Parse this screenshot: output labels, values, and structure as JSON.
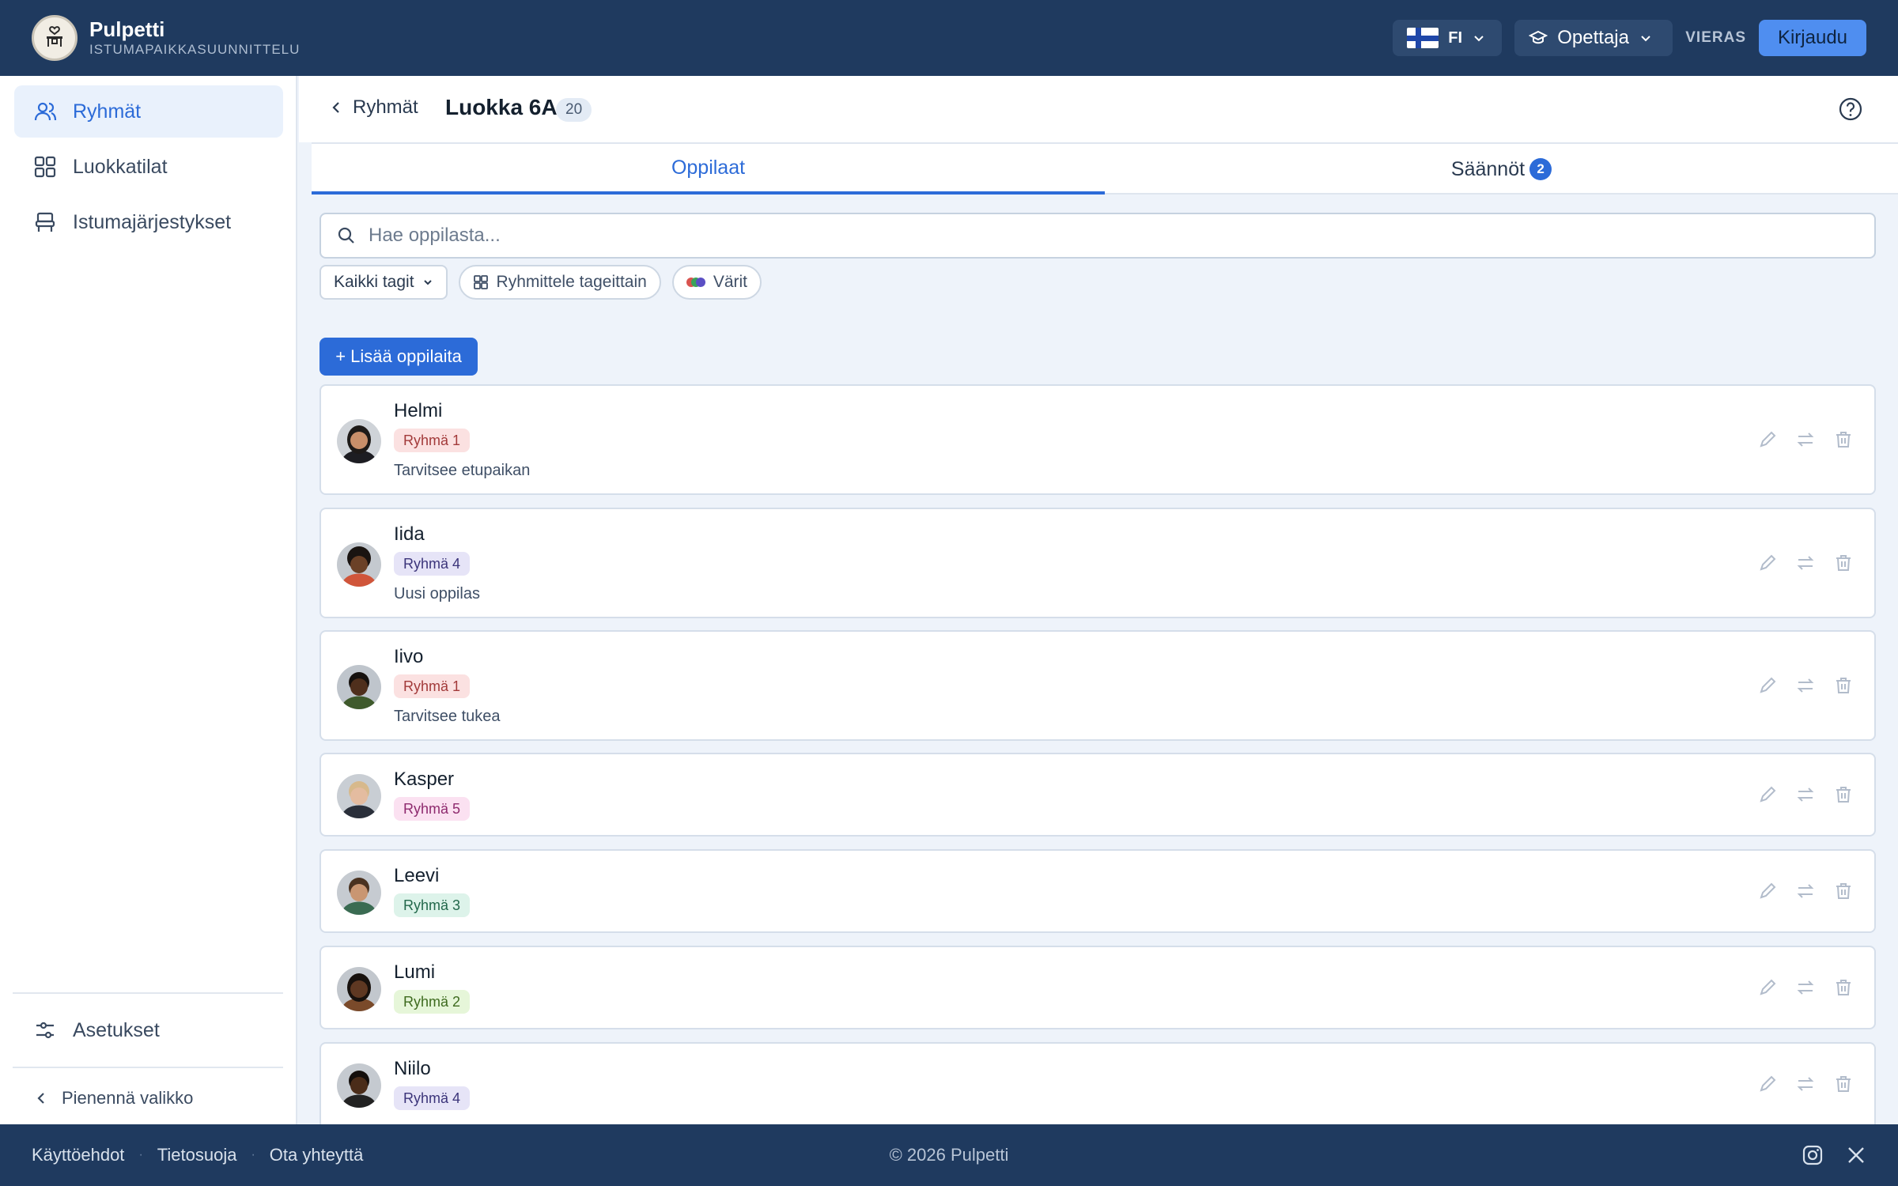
{
  "header": {
    "brand_name": "Pulpetti",
    "brand_subtitle": "ISTUMAPAIKKASUUNNITTELU",
    "language": "FI",
    "role": "Opettaja",
    "guest_label": "VIERAS",
    "login_label": "Kirjaudu"
  },
  "sidebar": {
    "items": [
      {
        "label": "Ryhmät",
        "icon": "users-icon",
        "active": true
      },
      {
        "label": "Luokkatilat",
        "icon": "grid-icon",
        "active": false
      },
      {
        "label": "Istumajärjestykset",
        "icon": "seat-icon",
        "active": false
      }
    ],
    "settings_label": "Asetukset",
    "collapse_label": "Pienennä valikko"
  },
  "page": {
    "back_label": "Ryhmät",
    "title": "Luokka 6A",
    "student_count": "20",
    "tabs": [
      {
        "label": "Oppilaat",
        "active": true
      },
      {
        "label": "Säännöt",
        "badge": "2",
        "active": false
      }
    ],
    "search_placeholder": "Hae oppilasta...",
    "filters": {
      "tags_label": "Kaikki tagit",
      "group_by_label": "Ryhmittele tageittain",
      "colors_label": "Värit"
    },
    "add_button_label": "+ Lisää oppilaita"
  },
  "students": [
    {
      "name": "Helmi",
      "tag": "Ryhmä 1",
      "note": "Tarvitsee etupaikan"
    },
    {
      "name": "Iida",
      "tag": "Ryhmä 4",
      "note": "Uusi oppilas"
    },
    {
      "name": "Iivo",
      "tag": "Ryhmä 1",
      "note": "Tarvitsee tukea"
    },
    {
      "name": "Kasper",
      "tag": "Ryhmä 5",
      "note": ""
    },
    {
      "name": "Leevi",
      "tag": "Ryhmä 3",
      "note": ""
    },
    {
      "name": "Lumi",
      "tag": "Ryhmä 2",
      "note": ""
    },
    {
      "name": "Niilo",
      "tag": "Ryhmä 4",
      "note": ""
    }
  ],
  "colors": {
    "header_bg": "#1f3a5f",
    "accent": "#2c6bd8",
    "tag_ryhma1": "#fbe1e1",
    "tag_ryhma2": "#e6f6d9",
    "tag_ryhma3": "#ddf3ea",
    "tag_ryhma4": "#e6e4f7",
    "tag_ryhma5": "#fbe1f1"
  },
  "footer": {
    "links": [
      "Käyttöehdot",
      "Tietosuoja",
      "Ota yhteyttä"
    ],
    "copyright": "© 2026 Pulpetti",
    "social_icons": [
      "instagram-icon",
      "x-icon"
    ]
  }
}
